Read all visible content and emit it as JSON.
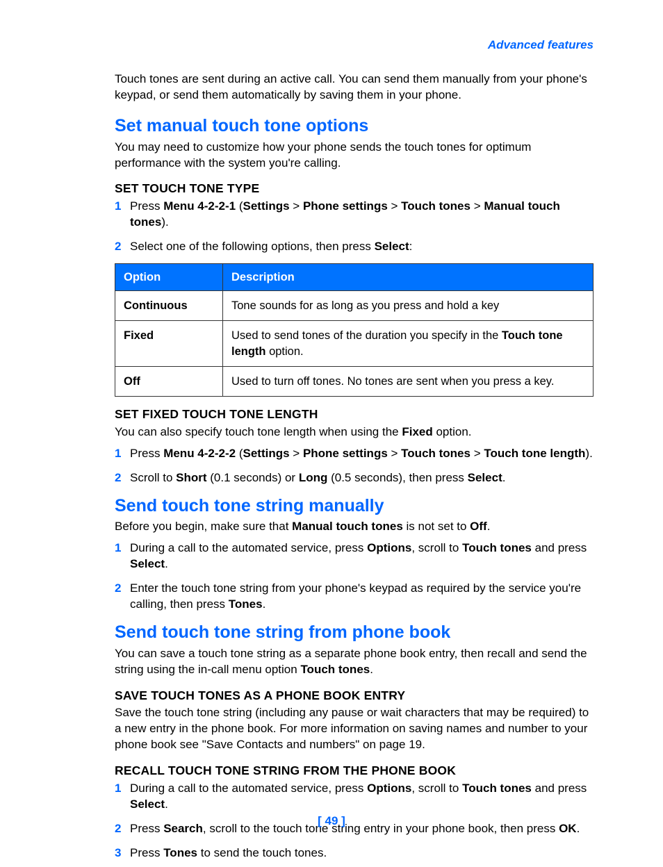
{
  "header": {
    "section_link": "Advanced features"
  },
  "intro": "Touch tones are sent during an active call. You can send them manually from your phone's keypad, or send them automatically by saving them in your phone.",
  "s1": {
    "title": "Set manual touch tone options",
    "desc": "You may need to customize how your phone sends the touch tones for optimum performance with the system you're calling.",
    "sub1": {
      "title": "SET TOUCH TONE TYPE",
      "step1_a": "Press ",
      "step1_b": "Menu 4-2-2-1",
      "step1_c": " (",
      "step1_d": "Settings",
      "step1_e": " > ",
      "step1_f": "Phone settings",
      "step1_g": " > ",
      "step1_h": "Touch tones",
      "step1_i": " > ",
      "step1_j": "Manual touch tones",
      "step1_k": ").",
      "step2_a": "Select one of the following options, then press ",
      "step2_b": "Select",
      "step2_c": ":",
      "table": {
        "h1": "Option",
        "h2": "Description",
        "rows": [
          {
            "opt": "Continuous",
            "desc_a": "Tone sounds for as long as you press and hold a key"
          },
          {
            "opt": "Fixed",
            "desc_a": "Used to send tones of the duration you specify in the ",
            "desc_b": "Touch tone length",
            "desc_c": " option."
          },
          {
            "opt": "Off",
            "desc_a": "Used to turn off tones. No tones are sent when you press a key."
          }
        ]
      }
    },
    "sub2": {
      "title": "SET FIXED TOUCH TONE LENGTH",
      "desc_a": "You can also specify touch tone length when using the ",
      "desc_b": "Fixed",
      "desc_c": " option.",
      "step1_a": "Press ",
      "step1_b": "Menu 4-2-2-2",
      "step1_c": " (",
      "step1_d": "Settings",
      "step1_e": " > ",
      "step1_f": "Phone settings",
      "step1_g": " > ",
      "step1_h": "Touch tones",
      "step1_i": " > ",
      "step1_j": "Touch tone length",
      "step1_k": ").",
      "step2_a": "Scroll to ",
      "step2_b": "Short",
      "step2_c": " (0.1 seconds) or ",
      "step2_d": "Long",
      "step2_e": " (0.5 seconds), then press ",
      "step2_f": "Select",
      "step2_g": "."
    }
  },
  "s2": {
    "title": "Send touch tone string manually",
    "desc_a": "Before you begin, make sure that ",
    "desc_b": "Manual touch tones",
    "desc_c": " is not set to ",
    "desc_d": "Off",
    "desc_e": ".",
    "step1_a": "During a call to the automated service, press ",
    "step1_b": "Options",
    "step1_c": ", scroll to ",
    "step1_d": "Touch tones",
    "step1_e": " and press ",
    "step1_f": "Select",
    "step1_g": ".",
    "step2_a": "Enter the touch tone string from your phone's keypad as required by the service you're calling, then press ",
    "step2_b": "Tones",
    "step2_c": "."
  },
  "s3": {
    "title": "Send touch tone string from phone book",
    "desc_a": "You can save a touch tone string as a separate phone book entry, then recall and send the string using the in-call menu option ",
    "desc_b": "Touch tones",
    "desc_c": ".",
    "sub1": {
      "title": "SAVE TOUCH TONES AS A PHONE BOOK ENTRY",
      "desc": "Save the touch tone string (including any pause or wait characters that may be required) to a new entry in the phone book. For more information on saving names and number to your phone book see \"Save Contacts and numbers\" on page 19."
    },
    "sub2": {
      "title": "RECALL TOUCH TONE STRING FROM THE PHONE BOOK",
      "step1_a": "During a call to the automated service, press ",
      "step1_b": "Options",
      "step1_c": ", scroll to ",
      "step1_d": "Touch tones",
      "step1_e": " and press ",
      "step1_f": "Select",
      "step1_g": ".",
      "step2_a": "Press ",
      "step2_b": "Search",
      "step2_c": ", scroll to the touch tone string entry in your phone book, then press ",
      "step2_d": "OK",
      "step2_e": ".",
      "step3_a": "Press ",
      "step3_b": "Tones",
      "step3_c": " to send the touch tones."
    }
  },
  "page_number": "[ 49 ]"
}
